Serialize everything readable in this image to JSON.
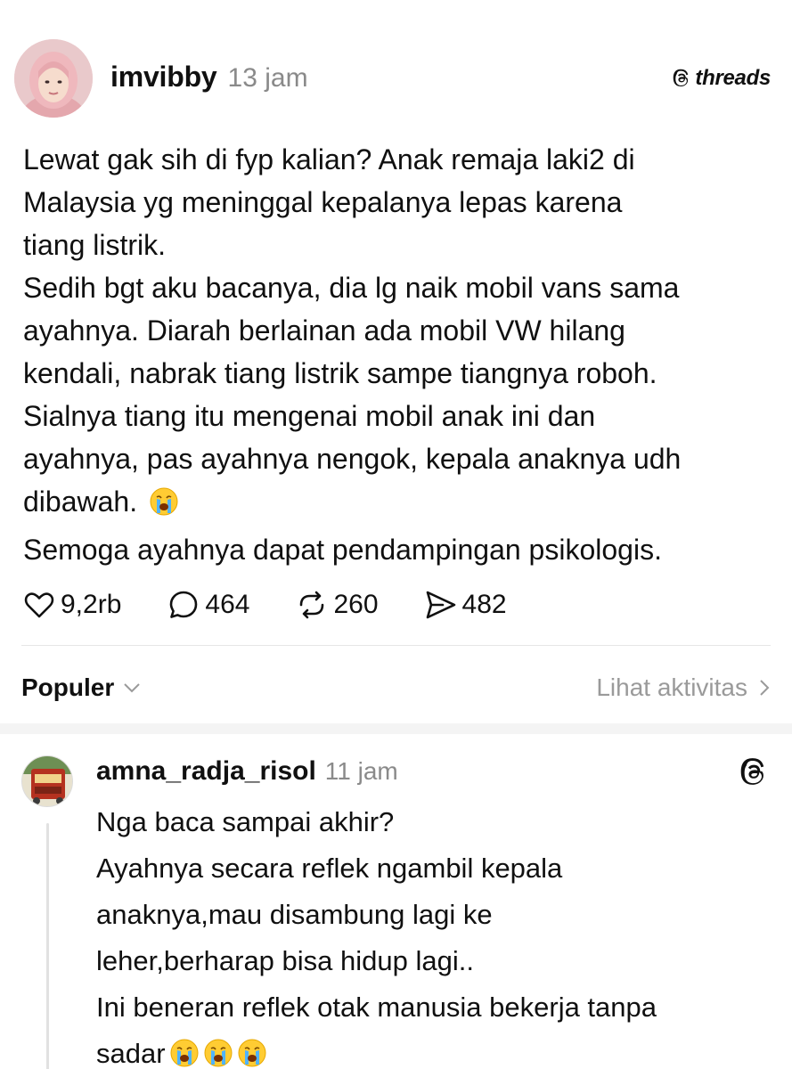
{
  "post": {
    "username": "imvibby",
    "timestamp": "13 jam",
    "brand": "threads",
    "body_lines": [
      "Lewat gak sih di fyp kalian? Anak remaja laki2 di",
      "Malaysia yg meninggal kepalanya lepas karena",
      "tiang listrik.",
      "Sedih bgt aku bacanya, dia lg naik mobil vans sama",
      "ayahnya. Diarah berlainan ada mobil VW hilang",
      "kendali, nabrak tiang listrik sampe tiangnya roboh.",
      "Sialnya tiang itu mengenai mobil anak ini dan",
      "ayahnya, pas ayahnya nengok, kepala anaknya udh",
      "dibawah.",
      "Semoga ayahnya dapat pendampingan psikologis."
    ],
    "emoji": "loudly-crying-face",
    "stats": {
      "likes": "9,2rb",
      "replies": "464",
      "reposts": "260",
      "shares": "482"
    }
  },
  "sort": {
    "label": "Populer",
    "activity_link": "Lihat aktivitas"
  },
  "reply": {
    "username": "amna_radja_risol",
    "timestamp": "11 jam",
    "body_lines": [
      "Nga baca sampai akhir?",
      "Ayahnya secara reflek ngambil kepala",
      "anaknya,mau disambung lagi ke",
      "leher,berharap bisa hidup lagi..",
      "Ini beneran reflek otak manusia bekerja tanpa",
      "sadar"
    ],
    "trailing_emoji_count": 3
  },
  "colors": {
    "text": "#101010",
    "muted": "#8a8a8a",
    "divider": "#e6e6e6",
    "band": "#f4f4f4"
  }
}
